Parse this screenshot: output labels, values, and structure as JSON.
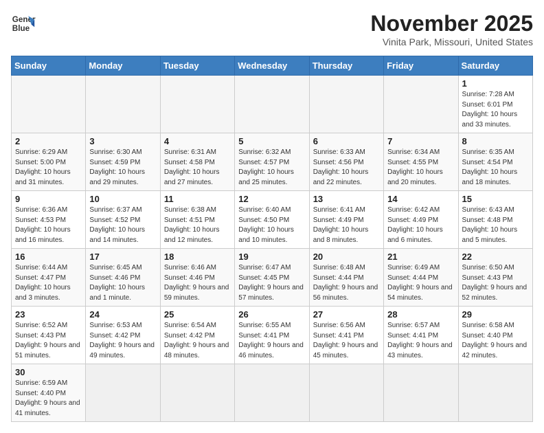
{
  "logo": {
    "line1": "General",
    "line2": "Blue"
  },
  "title": "November 2025",
  "location": "Vinita Park, Missouri, United States",
  "days_of_week": [
    "Sunday",
    "Monday",
    "Tuesday",
    "Wednesday",
    "Thursday",
    "Friday",
    "Saturday"
  ],
  "weeks": [
    [
      {
        "day": "",
        "info": ""
      },
      {
        "day": "",
        "info": ""
      },
      {
        "day": "",
        "info": ""
      },
      {
        "day": "",
        "info": ""
      },
      {
        "day": "",
        "info": ""
      },
      {
        "day": "",
        "info": ""
      },
      {
        "day": "1",
        "info": "Sunrise: 7:28 AM\nSunset: 6:01 PM\nDaylight: 10 hours and 33 minutes."
      }
    ],
    [
      {
        "day": "2",
        "info": "Sunrise: 6:29 AM\nSunset: 5:00 PM\nDaylight: 10 hours and 31 minutes."
      },
      {
        "day": "3",
        "info": "Sunrise: 6:30 AM\nSunset: 4:59 PM\nDaylight: 10 hours and 29 minutes."
      },
      {
        "day": "4",
        "info": "Sunrise: 6:31 AM\nSunset: 4:58 PM\nDaylight: 10 hours and 27 minutes."
      },
      {
        "day": "5",
        "info": "Sunrise: 6:32 AM\nSunset: 4:57 PM\nDaylight: 10 hours and 25 minutes."
      },
      {
        "day": "6",
        "info": "Sunrise: 6:33 AM\nSunset: 4:56 PM\nDaylight: 10 hours and 22 minutes."
      },
      {
        "day": "7",
        "info": "Sunrise: 6:34 AM\nSunset: 4:55 PM\nDaylight: 10 hours and 20 minutes."
      },
      {
        "day": "8",
        "info": "Sunrise: 6:35 AM\nSunset: 4:54 PM\nDaylight: 10 hours and 18 minutes."
      }
    ],
    [
      {
        "day": "9",
        "info": "Sunrise: 6:36 AM\nSunset: 4:53 PM\nDaylight: 10 hours and 16 minutes."
      },
      {
        "day": "10",
        "info": "Sunrise: 6:37 AM\nSunset: 4:52 PM\nDaylight: 10 hours and 14 minutes."
      },
      {
        "day": "11",
        "info": "Sunrise: 6:38 AM\nSunset: 4:51 PM\nDaylight: 10 hours and 12 minutes."
      },
      {
        "day": "12",
        "info": "Sunrise: 6:40 AM\nSunset: 4:50 PM\nDaylight: 10 hours and 10 minutes."
      },
      {
        "day": "13",
        "info": "Sunrise: 6:41 AM\nSunset: 4:49 PM\nDaylight: 10 hours and 8 minutes."
      },
      {
        "day": "14",
        "info": "Sunrise: 6:42 AM\nSunset: 4:49 PM\nDaylight: 10 hours and 6 minutes."
      },
      {
        "day": "15",
        "info": "Sunrise: 6:43 AM\nSunset: 4:48 PM\nDaylight: 10 hours and 5 minutes."
      }
    ],
    [
      {
        "day": "16",
        "info": "Sunrise: 6:44 AM\nSunset: 4:47 PM\nDaylight: 10 hours and 3 minutes."
      },
      {
        "day": "17",
        "info": "Sunrise: 6:45 AM\nSunset: 4:46 PM\nDaylight: 10 hours and 1 minute."
      },
      {
        "day": "18",
        "info": "Sunrise: 6:46 AM\nSunset: 4:46 PM\nDaylight: 9 hours and 59 minutes."
      },
      {
        "day": "19",
        "info": "Sunrise: 6:47 AM\nSunset: 4:45 PM\nDaylight: 9 hours and 57 minutes."
      },
      {
        "day": "20",
        "info": "Sunrise: 6:48 AM\nSunset: 4:44 PM\nDaylight: 9 hours and 56 minutes."
      },
      {
        "day": "21",
        "info": "Sunrise: 6:49 AM\nSunset: 4:44 PM\nDaylight: 9 hours and 54 minutes."
      },
      {
        "day": "22",
        "info": "Sunrise: 6:50 AM\nSunset: 4:43 PM\nDaylight: 9 hours and 52 minutes."
      }
    ],
    [
      {
        "day": "23",
        "info": "Sunrise: 6:52 AM\nSunset: 4:43 PM\nDaylight: 9 hours and 51 minutes."
      },
      {
        "day": "24",
        "info": "Sunrise: 6:53 AM\nSunset: 4:42 PM\nDaylight: 9 hours and 49 minutes."
      },
      {
        "day": "25",
        "info": "Sunrise: 6:54 AM\nSunset: 4:42 PM\nDaylight: 9 hours and 48 minutes."
      },
      {
        "day": "26",
        "info": "Sunrise: 6:55 AM\nSunset: 4:41 PM\nDaylight: 9 hours and 46 minutes."
      },
      {
        "day": "27",
        "info": "Sunrise: 6:56 AM\nSunset: 4:41 PM\nDaylight: 9 hours and 45 minutes."
      },
      {
        "day": "28",
        "info": "Sunrise: 6:57 AM\nSunset: 4:41 PM\nDaylight: 9 hours and 43 minutes."
      },
      {
        "day": "29",
        "info": "Sunrise: 6:58 AM\nSunset: 4:40 PM\nDaylight: 9 hours and 42 minutes."
      }
    ],
    [
      {
        "day": "30",
        "info": "Sunrise: 6:59 AM\nSunset: 4:40 PM\nDaylight: 9 hours and 41 minutes."
      },
      {
        "day": "",
        "info": ""
      },
      {
        "day": "",
        "info": ""
      },
      {
        "day": "",
        "info": ""
      },
      {
        "day": "",
        "info": ""
      },
      {
        "day": "",
        "info": ""
      },
      {
        "day": "",
        "info": ""
      }
    ]
  ]
}
